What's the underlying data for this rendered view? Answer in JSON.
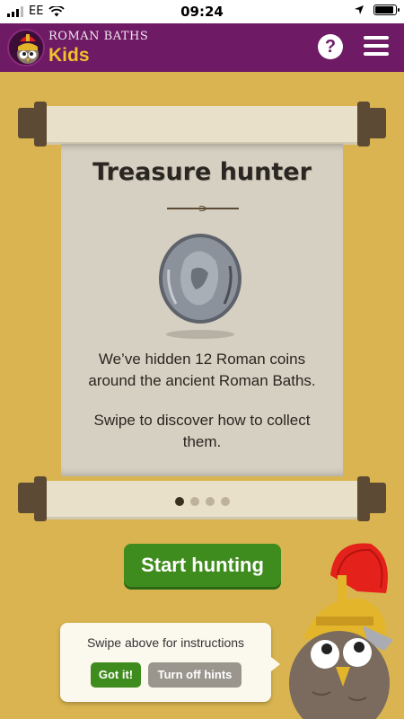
{
  "status_bar": {
    "carrier": "EE",
    "time": "09:24",
    "battery_level": 0.92
  },
  "header": {
    "brand_line1": "ROMAN BATHS",
    "brand_line2": "Kids",
    "help_label": "?",
    "help_icon": "help-icon",
    "menu_icon": "hamburger-menu-icon",
    "colors": {
      "header_bg": "#6e1a64",
      "brand_accent": "#f2c22d"
    }
  },
  "scroll": {
    "title": "Treasure hunter",
    "image": "roman-coin-icon",
    "description": "We’ve hidden 12 Roman coins around the ancient Roman Baths.",
    "hint": "Swipe to discover how to collect them."
  },
  "pagination": {
    "total": 4,
    "active": 1
  },
  "primary_action": {
    "label": "Start hunting",
    "color": "#3f8c1e"
  },
  "hint_bubble": {
    "text": "Swipe above for instructions",
    "got_it_label": "Got it!",
    "turn_off_label": "Turn off hints"
  },
  "mascot": {
    "icon": "roman-owl-mascot"
  },
  "colors": {
    "background": "#d9b450",
    "scroll_paper": "#d6d0c2",
    "rod_caps": "#5c4a34"
  }
}
